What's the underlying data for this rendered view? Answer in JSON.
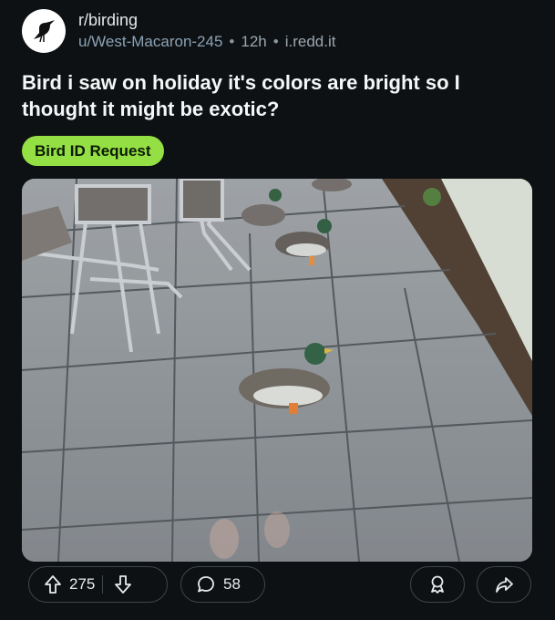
{
  "post": {
    "subreddit": "r/birding",
    "author": "u/West-Macaron-245",
    "time": "12h",
    "domain": "i.redd.it",
    "title": "Bird i saw on holiday it's colors are bright so I thought it might be exotic?",
    "flair": "Bird ID Request",
    "upvotes": "275",
    "comments": "58"
  },
  "icons": {
    "avatar": "crow-icon",
    "upvote": "arrow-up-icon",
    "downvote": "arrow-down-icon",
    "comment": "speech-bubble-icon",
    "award": "award-icon",
    "share": "share-arrow-icon"
  },
  "colors": {
    "background": "#0e1113",
    "flair": "#94e044",
    "username": "#8ba2b5"
  }
}
